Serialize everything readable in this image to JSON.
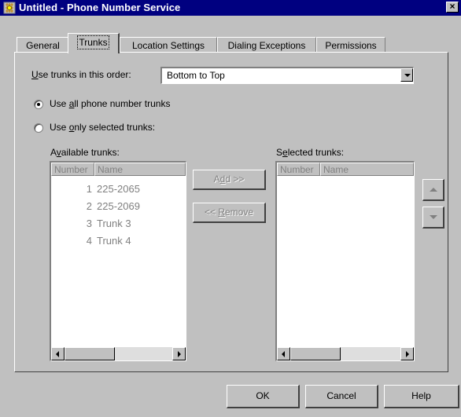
{
  "window": {
    "title": "Untitled - Phone Number Service",
    "close_glyph": "×"
  },
  "tabs": [
    {
      "label": "General",
      "active": false
    },
    {
      "label": "Trunks",
      "active": true
    },
    {
      "label": "Location Settings",
      "active": false
    },
    {
      "label": "Dialing Exceptions",
      "active": false
    },
    {
      "label": "Permissions",
      "active": false
    }
  ],
  "trunk_order": {
    "label_prefix": "",
    "label_access": "U",
    "label_rest": "se trunks in this order:",
    "value": "Bottom to Top"
  },
  "options": {
    "use_all": {
      "prefix": "Use ",
      "access": "a",
      "rest": "ll phone number trunks",
      "checked": true
    },
    "use_selected": {
      "prefix": "Use ",
      "access": "o",
      "rest": "nly selected trunks:",
      "checked": false
    }
  },
  "available": {
    "label_prefix": "A",
    "label_access": "v",
    "label_rest": "ailable trunks:",
    "columns": [
      "Number",
      "Name"
    ],
    "rows": [
      {
        "number": "1",
        "name": "225-2065"
      },
      {
        "number": "2",
        "name": "225-2069"
      },
      {
        "number": "3",
        "name": "Trunk 3"
      },
      {
        "number": "4",
        "name": "Trunk 4"
      }
    ]
  },
  "selected": {
    "label_prefix": "S",
    "label_access": "e",
    "label_rest": "lected trunks:",
    "columns": [
      "Number",
      "Name"
    ],
    "rows": []
  },
  "transfer": {
    "add": {
      "prefix": "A",
      "access": "d",
      "rest": "d >>",
      "enabled": false
    },
    "remove": {
      "prefix": "<< ",
      "access": "R",
      "rest": "emove",
      "enabled": false
    }
  },
  "footer": {
    "ok": "OK",
    "cancel": "Cancel",
    "help": "Help"
  },
  "icons": {
    "app": "phone-service-icon",
    "close": "close-icon",
    "move_up": "arrow-up-icon",
    "move_down": "arrow-down-icon"
  },
  "colors": {
    "titlebar": "#000080",
    "face": "#c0c0c0",
    "disabled_text": "#808080"
  }
}
